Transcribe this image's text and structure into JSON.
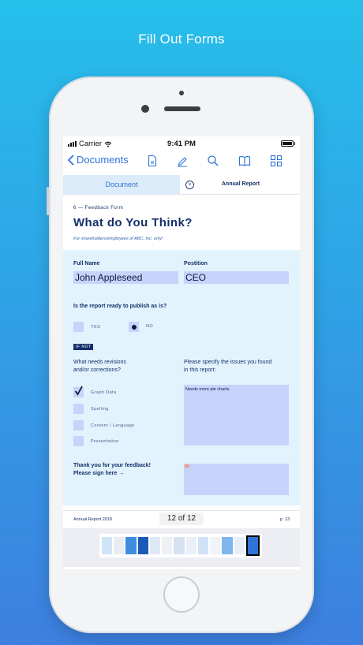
{
  "headline": "Fill Out Forms",
  "status": {
    "carrier": "Carrier",
    "time": "9:41 PM"
  },
  "toolbar": {
    "back_label": "Documents",
    "icons": [
      "document-icon",
      "pen-icon",
      "search-icon",
      "book-icon",
      "grid-icon"
    ]
  },
  "tabs": {
    "active": "Document",
    "other": "Annual Report"
  },
  "document": {
    "kicker": "6 — Feedback Form",
    "title": "What do You Think?",
    "subtitle": "For shareholders/employees of ABC, Inc. only!",
    "full_name_label": "Full Name",
    "full_name_value": "John Appleseed",
    "position_label": "Postition",
    "position_value": "CEO",
    "question": "Is the report ready to publish as is?",
    "yes_label": "YES",
    "no_label": "NO",
    "publish_answer": "no",
    "if_not": "IF NOT",
    "revisions_label_1": "What needs revisions",
    "revisions_label_2": "and/or corrections?",
    "issues_label_1": "Please specify the issues you found",
    "issues_label_2": "in this report:",
    "options": [
      {
        "label": "Graph Data",
        "checked": true
      },
      {
        "label": "Spelling",
        "checked": false
      },
      {
        "label": "Content / Language",
        "checked": false
      },
      {
        "label": "Presentation",
        "checked": false
      }
    ],
    "issues_value": "Needs more pie charts.",
    "thanks_1": "Thank you for your feedback!",
    "thanks_2": "Please sign here →",
    "footer_left": "Annual Report 2018",
    "footer_right": "p. 13"
  },
  "pager": "12 of 12",
  "thumbnails_count": 13,
  "colors": {
    "accent": "#2f73d6",
    "navy": "#14306a",
    "field": "#c7d3fb",
    "form_bg": "#e3f3fd"
  }
}
